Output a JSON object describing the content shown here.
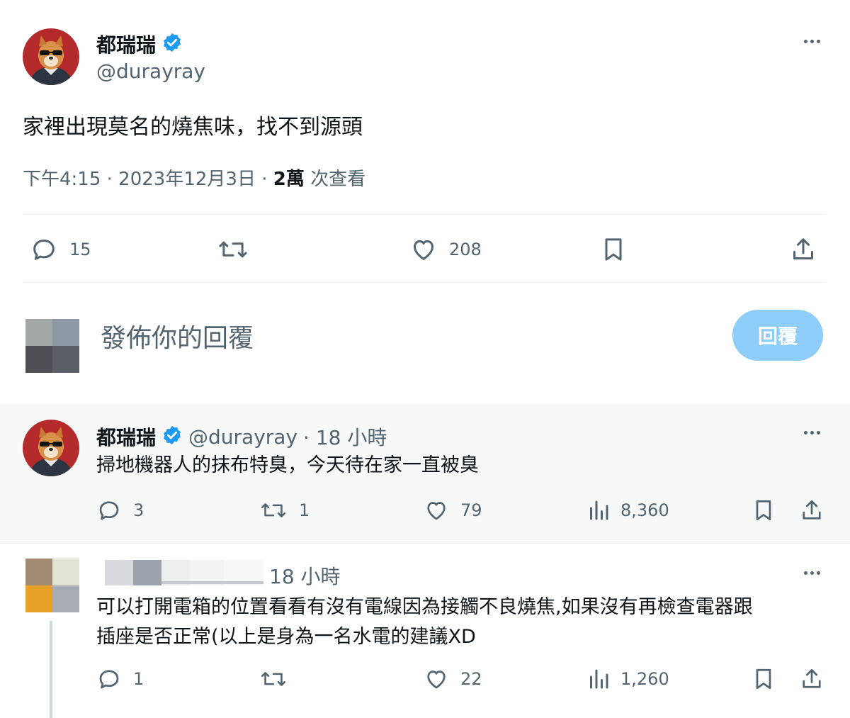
{
  "main_tweet": {
    "author_name": "都瑞瑞",
    "author_handle": "@durayray",
    "text": "家裡出現莫名的燒焦味，找不到源頭",
    "time_date": "下午4:15 · 2023年12月3日 · ",
    "views_count": "2萬",
    "views_label": " 次查看",
    "actions": {
      "replies": "15",
      "likes": "208"
    }
  },
  "compose": {
    "placeholder": "發佈你的回覆",
    "button_label": "回覆"
  },
  "reply_1": {
    "author_name": "都瑞瑞",
    "author_handle": "@durayray",
    "time": "· 18 小時",
    "text": "掃地機器人的抹布特臭，今天待在家一直被臭",
    "actions": {
      "replies": "3",
      "retweets": "1",
      "likes": "79",
      "views": "8,360"
    }
  },
  "reply_2": {
    "time": "18 小時",
    "text_line1": "可以打開電箱的位置看看有沒有電線因為接觸不良燒焦,如果沒有再檢查電器跟",
    "text_line2": "插座是否正常(以上是身為一名水電的建議XD",
    "actions": {
      "replies": "1",
      "likes": "22",
      "views": "1,260"
    }
  },
  "colors": {
    "verified": "#1d9bf0",
    "reply_button": "#8ecdf8",
    "secondary_text": "#536471",
    "highlight_bg": "#f7f9f9"
  }
}
